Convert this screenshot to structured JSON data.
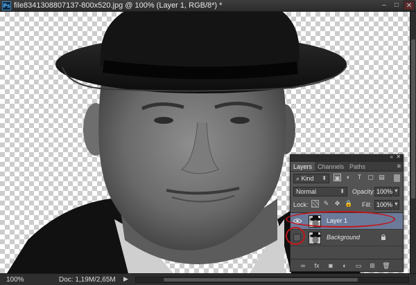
{
  "app": {
    "logo": "Ps"
  },
  "window": {
    "title": "file8341308807137-800x520.jpg @ 100% (Layer 1, RGB/8*) *",
    "minimize": "–",
    "maximize": "□",
    "close": "✕"
  },
  "status": {
    "zoom": "100%",
    "doc": "Doc: 1,19M/2,65M",
    "arrow": "▶"
  },
  "layers_panel": {
    "collapse": "«",
    "close": "✕",
    "menu": "≡",
    "tabs": [
      "Layers",
      "Channels",
      "Paths"
    ],
    "filter_kind": "Kind",
    "blend_mode": "Normal",
    "opacity_label": "Opacity:",
    "opacity_value": "100%",
    "lock_label": "Lock:",
    "fill_label": "Fill:",
    "fill_value": "100%",
    "layers": [
      {
        "name": "Layer 1",
        "visible": true,
        "selected": true,
        "locked": false
      },
      {
        "name": "Background",
        "visible": false,
        "selected": false,
        "locked": true
      }
    ],
    "bottom_icons": [
      "link-icon",
      "fx-icon",
      "mask-icon",
      "adjustment-icon",
      "group-folder-icon",
      "new-layer-icon",
      "trash-icon"
    ],
    "bottom_glyphs": [
      "∞",
      "fx",
      "◙",
      "◐",
      "▭",
      "⊞",
      "🗑"
    ]
  },
  "colors": {
    "annotation": "#c0161b",
    "selected_layer": "#6c7a99",
    "panel_bg": "#535353"
  }
}
